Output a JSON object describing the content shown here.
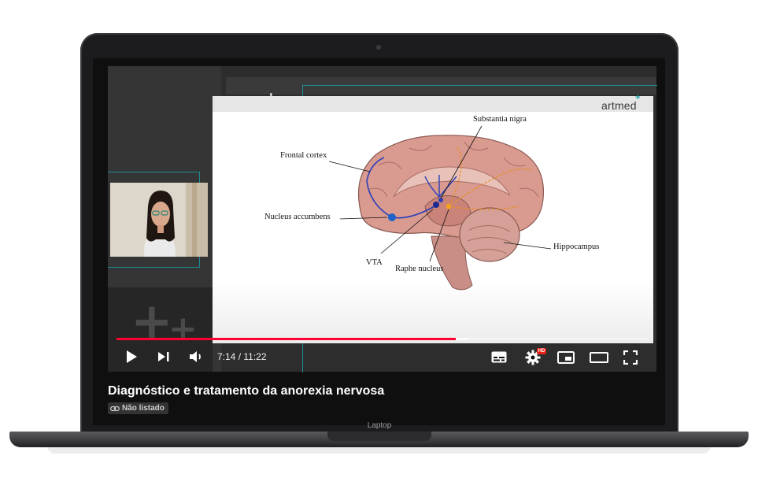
{
  "laptop": {
    "label": "Laptop"
  },
  "video": {
    "title": "Diagnóstico e tratamento da anorexia nervosa",
    "visibility_badge": "Não listado",
    "time_display": "7:14 / 11:22",
    "progress_played_fraction": 0.64,
    "settings_badge": "HD"
  },
  "slide": {
    "logo": "artmed",
    "labels": {
      "substantia_nigra": "Substantia nigra",
      "frontal_cortex": "Frontal cortex",
      "nucleus_accumbens": "Nucleus accumbens",
      "hippocampus": "Hippocampus",
      "vta": "VTA",
      "raphe_nucleus": "Raphe nucleus"
    }
  },
  "controls": {
    "play": "play-icon",
    "next": "next-icon",
    "volume": "volume-icon",
    "subtitles": "subtitles-icon",
    "settings": "gear-icon",
    "miniplayer": "miniplayer-icon",
    "theater": "theater-icon",
    "fullscreen": "fullscreen-icon"
  },
  "colors": {
    "progress": "#ff0033",
    "accent_teal": "#1f8b93",
    "badge_red": "#e62117"
  }
}
